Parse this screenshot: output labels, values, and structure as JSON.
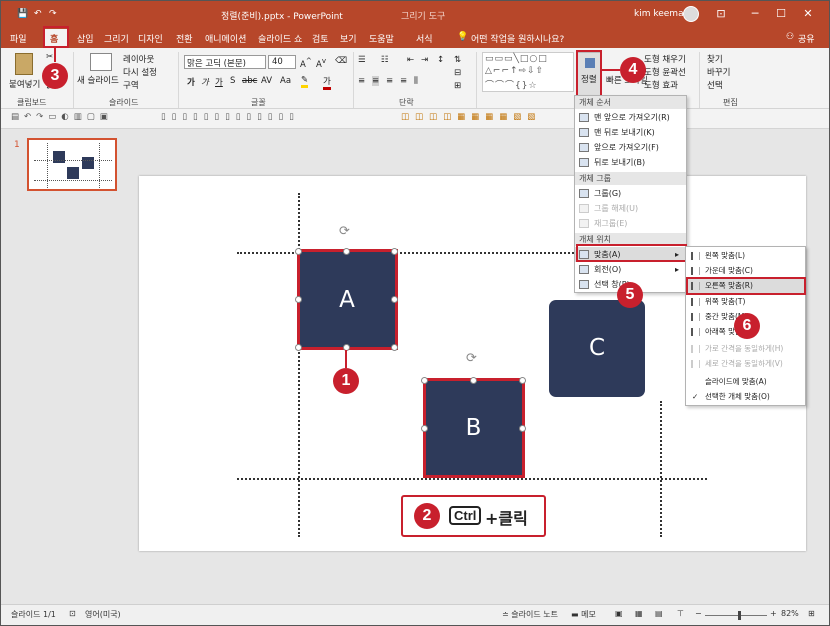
{
  "window": {
    "title": "정렬(준비).pptx - PowerPoint",
    "context_tool": "그리기 도구",
    "tell_me": "어떤 작업을 원하시나요?",
    "user": "kim keeman",
    "share": "공유",
    "controls": {
      "ribbon_opts": "⊡",
      "minimize": "─",
      "maximize": "☐",
      "close": "✕"
    }
  },
  "tabs": [
    "파일",
    "홈",
    "삽입",
    "그리기",
    "디자인",
    "전환",
    "애니메이션",
    "슬라이드 쇼",
    "검토",
    "보기",
    "도움말",
    "서식"
  ],
  "active_tab": "홈",
  "ribbon": {
    "clipboard": {
      "paste": "붙여넣기",
      "label": "클립보드"
    },
    "slides": {
      "new_slide": "새 슬라이드",
      "layout": "레이아웃",
      "reset": "다시 설정",
      "section": "구역",
      "label": "슬라이드"
    },
    "font": {
      "name": "맑은 고딕 (본문)",
      "size": "40",
      "bold": "가",
      "italic": "가",
      "underline": "가",
      "shadow": "S",
      "strike": "abc",
      "spacing": "AV",
      "change_case": "Aa",
      "label": "글꼴"
    },
    "paragraph": {
      "label": "단락"
    },
    "drawing": {
      "arrange": "정렬",
      "quick_styles": "빠른 스타일",
      "fill": "도형 채우기",
      "outline": "도형 윤곽선",
      "effects": "도형 효과"
    },
    "editing": {
      "find": "찾기",
      "replace": "바꾸기",
      "select": "선택",
      "label": "편집"
    }
  },
  "thumbnail": {
    "number": "1"
  },
  "slide": {
    "shapes": [
      {
        "label": "A",
        "color": "#2e3a5a"
      },
      {
        "label": "B",
        "color": "#2e3a5a"
      },
      {
        "label": "C",
        "color": "#2e3a5a"
      }
    ]
  },
  "callouts": {
    "step1": "1",
    "step2": "2",
    "step3": "3",
    "step4": "4",
    "step5": "5",
    "step6": "6",
    "ctrl_key": "Ctrl",
    "plus_click": "+클릭"
  },
  "arrange_menu": {
    "order_header": "개체 순서",
    "bring_front": "맨 앞으로 가져오기(R)",
    "send_back": "맨 뒤로 보내기(K)",
    "bring_forward": "앞으로 가져오기(F)",
    "send_backward": "뒤로 보내기(B)",
    "group_header": "개체 그룹",
    "group": "그룹(G)",
    "ungroup": "그룹 해제(U)",
    "regroup": "재그룹(E)",
    "position_header": "개체 위치",
    "align": "맞춤(A)",
    "rotate": "회전(O)",
    "selection_pane": "선택 창(P)..."
  },
  "align_menu": {
    "left": "왼쪽 맞춤(L)",
    "center": "가운데 맞춤(C)",
    "right": "오른쪽 맞춤(R)",
    "top": "위쪽 맞춤(T)",
    "middle": "중간 맞춤(M)",
    "bottom": "아래쪽 맞춤(B)",
    "dist_h": "가로 간격을 동일하게(H)",
    "dist_v": "세로 간격을 동일하게(V)",
    "to_slide": "슬라이드에 맞춤(A)",
    "to_selected": "선택한 개체 맞춤(O)",
    "check": "✓"
  },
  "status": {
    "slide": "슬라이드 1/1",
    "lang": "영어(미국)",
    "notes": "슬라이드 노트",
    "comments": "메모",
    "zoom": "82%",
    "zoom_level": 0.55
  }
}
